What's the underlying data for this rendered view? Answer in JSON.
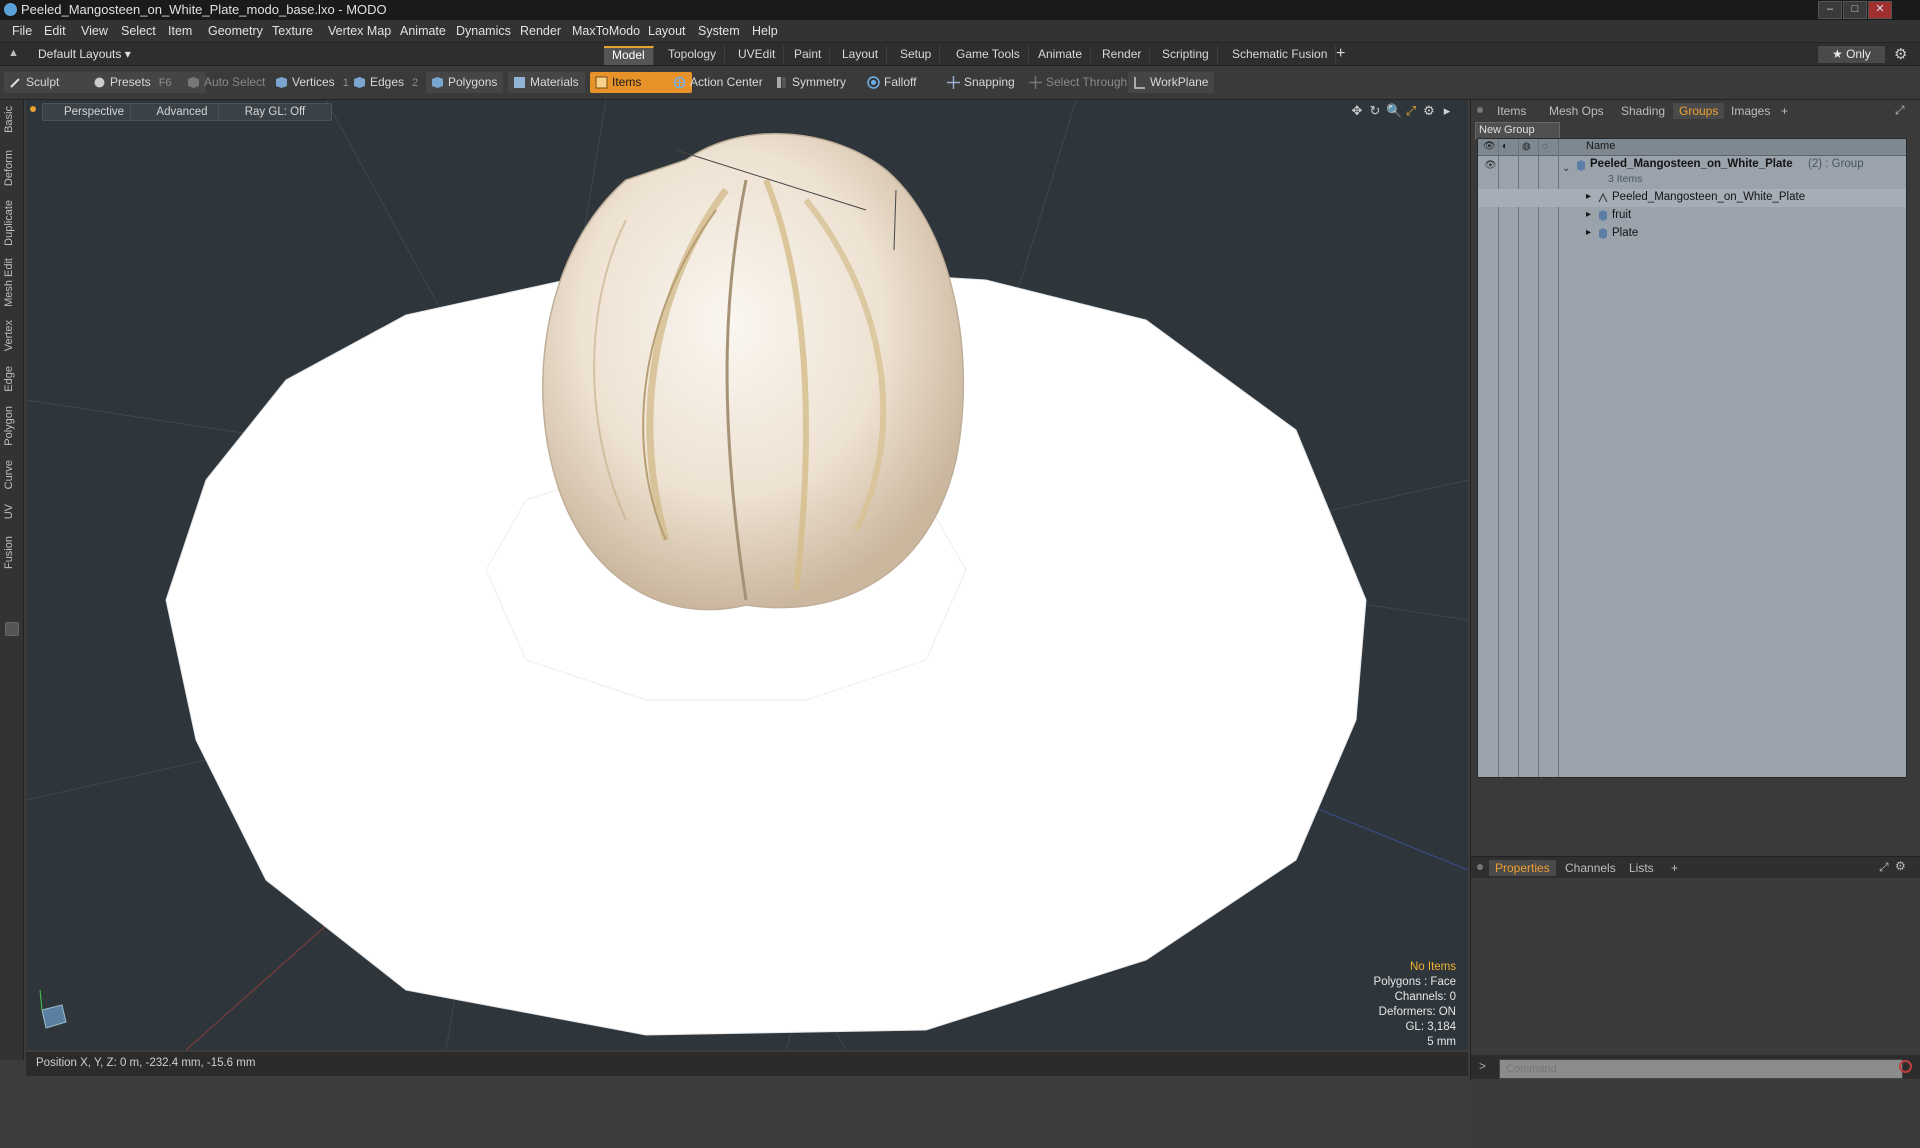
{
  "window": {
    "title": "Peeled_Mangosteen_on_White_Plate_modo_base.lxo - MODO",
    "controls": [
      "–",
      "□",
      "✕"
    ]
  },
  "menu": [
    "File",
    "Edit",
    "View",
    "Select",
    "Item",
    "Geometry",
    "Texture",
    "Vertex Map",
    "Animate",
    "Dynamics",
    "Render",
    "MaxToModo",
    "Layout",
    "System",
    "Help"
  ],
  "layout_selector": "Default Layouts ▾",
  "mode_tabs": [
    "Model",
    "Topology",
    "UVEdit",
    "Paint",
    "Layout",
    "Setup",
    "Game Tools",
    "Animate",
    "Render",
    "Scripting",
    "Schematic Fusion"
  ],
  "mode_tab_add": "+",
  "only_button": "★  Only",
  "toolbar": {
    "sculpt": "Sculpt",
    "presets": "Presets",
    "presets_key": "F6",
    "auto_select": "Auto Select",
    "vertices": "Vertices",
    "vertices_count": "1",
    "edges": "Edges",
    "edges_count": "2",
    "polygons": "Polygons",
    "materials": "Materials",
    "items": "Items",
    "action_center": "Action Center",
    "symmetry": "Symmetry",
    "falloff": "Falloff",
    "snapping": "Snapping",
    "select_through": "Select Through",
    "workplane": "WorkPlane"
  },
  "left_tabs": [
    "Basic",
    "Deform",
    "Duplicate",
    "Mesh Edit",
    "Vertex",
    "Edge",
    "Polygon",
    "Curve",
    "UV",
    "Fusion"
  ],
  "viewport": {
    "perspective": "Perspective",
    "advanced": "Advanced",
    "raygl": "Ray GL: Off",
    "hud": {
      "selection": "No Items",
      "polygons": "Polygons : Face",
      "channels": "Channels: 0",
      "deformers": "Deformers: ON",
      "gl": "GL: 3,184",
      "scale": "5 mm"
    }
  },
  "status": {
    "position": "Position X, Y, Z:  0 m, -232.4 mm, -15.6 mm"
  },
  "right_panel": {
    "tabs": [
      "Items",
      "Mesh Ops",
      "Shading",
      "Groups",
      "Images",
      "+"
    ],
    "active_tab": "Groups",
    "new_group": "New Group",
    "column_name": "Name",
    "group": {
      "name": "Peeled_Mangosteen_on_White_Plate",
      "suffix": "(2) : Group",
      "count": "3 Items"
    },
    "children": [
      "Peeled_Mangosteen_on_White_Plate",
      "fruit",
      "Plate"
    ],
    "bottom_tabs": [
      "Properties",
      "Channels",
      "Lists",
      "+"
    ],
    "command_placeholder": "Command"
  },
  "colors": {
    "accent": "#e8922a",
    "viewport_bg": "#2e363c",
    "outliner_bg": "#9aa3ac"
  }
}
